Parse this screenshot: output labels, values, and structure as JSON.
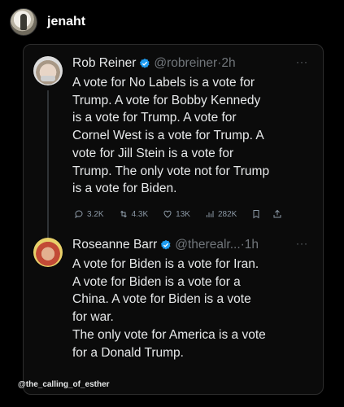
{
  "header": {
    "username": "jenaht"
  },
  "tweets": [
    {
      "display_name": "Rob Reiner",
      "handle": "@robreiner",
      "separator": "·",
      "time": "2h",
      "text": "A vote for No Labels is a vote for\nTrump. A vote for Bobby Kennedy\nis a vote for Trump. A vote for\nCornel West is a vote for Trump. A\nvote for Jill Stein is a vote for\nTrump. The only vote not for Trump\nis a vote for Biden.",
      "stats": {
        "replies": "3.2K",
        "reposts": "4.3K",
        "likes": "13K",
        "views": "282K"
      }
    },
    {
      "display_name": "Roseanne Barr",
      "handle": "@therealr...",
      "separator": "·",
      "time": "1h",
      "text": "A vote for Biden is a vote for Iran.\nA vote for Biden is a vote for a\nChina. A vote for Biden is a vote\nfor war.\nThe only vote for America is a vote\nfor a Donald Trump."
    }
  ],
  "more_label": "···",
  "watermark": "@the_calling_of_esther",
  "colors": {
    "background": "#000000",
    "verified": "#1d9bf0",
    "muted": "#71767b"
  },
  "icons": [
    "verified-badge-icon",
    "reply-icon",
    "repost-icon",
    "like-icon",
    "views-icon",
    "bookmark-icon",
    "share-icon",
    "more-icon"
  ]
}
